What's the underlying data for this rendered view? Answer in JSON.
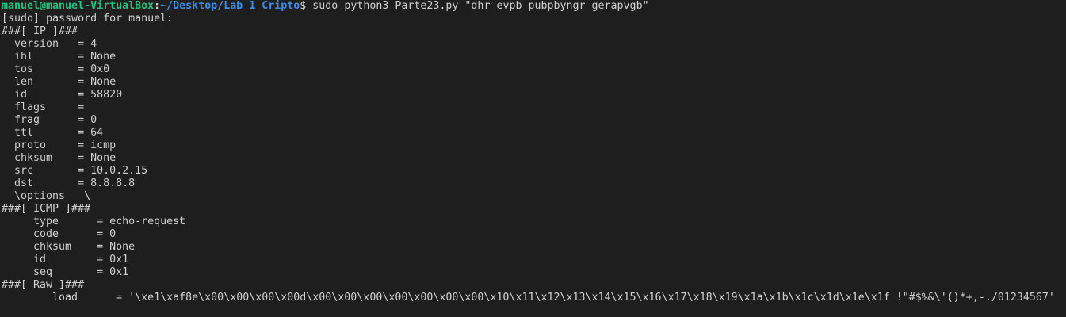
{
  "colors": {
    "background": "#1e1e1e",
    "foreground": "#d0d0d0",
    "prompt_user": "#26c281",
    "prompt_path": "#3b8eea"
  },
  "prompt": {
    "user_host": "manuel@manuel-VirtualBox",
    "separator": ":",
    "path": "~/Desktop/Lab 1 Cripto",
    "command": "$ sudo python3 Parte23.py \"dhr evpb pubpbyngr gerapvgb\""
  },
  "output_lines": [
    "[sudo] password for manuel:",
    "###[ IP ]###",
    "  version   = 4",
    "  ihl       = None",
    "  tos       = 0x0",
    "  len       = None",
    "  id        = 58820",
    "  flags     =",
    "  frag      = 0",
    "  ttl       = 64",
    "  proto     = icmp",
    "  chksum    = None",
    "  src       = 10.0.2.15",
    "  dst       = 8.8.8.8",
    "  \\options   \\",
    "###[ ICMP ]###",
    "     type      = echo-request",
    "     code      = 0",
    "     chksum    = None",
    "     id        = 0x1",
    "     seq       = 0x1",
    "###[ Raw ]###",
    "        load      = '\\xe1\\xaf8e\\x00\\x00\\x00\\x00d\\x00\\x00\\x00\\x00\\x00\\x00\\x00\\x10\\x11\\x12\\x13\\x14\\x15\\x16\\x17\\x18\\x19\\x1a\\x1b\\x1c\\x1d\\x1e\\x1f !\"#$%&\\'()*+,-./01234567'"
  ]
}
